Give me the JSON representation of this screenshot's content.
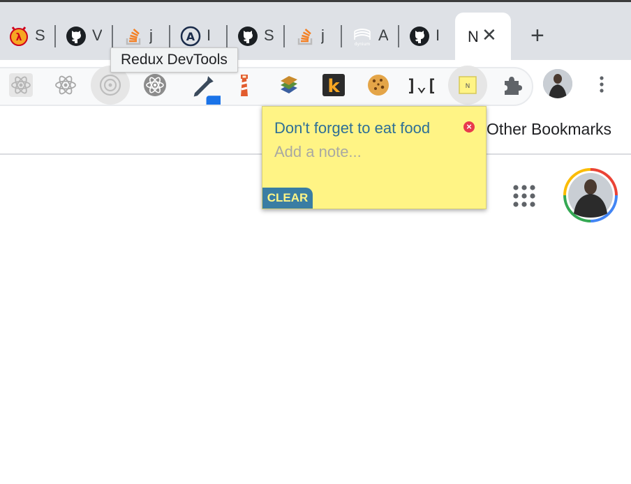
{
  "tabs": [
    {
      "icon": "lambda-icon",
      "title": "S"
    },
    {
      "icon": "github-icon",
      "title": "V"
    },
    {
      "icon": "stackoverflow-icon",
      "title": "j"
    },
    {
      "icon": "apollo-icon",
      "title": "I"
    },
    {
      "icon": "github-icon",
      "title": "S"
    },
    {
      "icon": "stackoverflow-icon",
      "title": "j"
    },
    {
      "icon": "dynium-icon",
      "title": "A"
    },
    {
      "icon": "github-icon",
      "title": "I"
    },
    {
      "icon": "new-tab-icon",
      "title": "N",
      "active": true
    }
  ],
  "dynium_label": "dynium",
  "tooltip": "Redux DevTools",
  "extensions": [
    "react-devtools-icon",
    "react-icon",
    "redux-devtools-icon",
    "react-alt-icon",
    "eyedropper-icon",
    "lighthouse-icon",
    "stack-books-icon",
    "k-icon",
    "cookie-icon",
    "bracket-icon",
    "sticky-note-icon",
    "puzzle-icon"
  ],
  "extension_glyphs": {
    "k": "k",
    "bracket": "]⌄["
  },
  "bookmarks": {
    "other": "Other Bookmarks"
  },
  "note": {
    "items": [
      "Don't forget to eat food"
    ],
    "placeholder": "Add a note...",
    "delete_glyph": "×",
    "clear_label": "CLEAR"
  },
  "colors": {
    "note_bg": "#fff485",
    "note_text": "#2e6f96",
    "clear_bg": "#3a7da3",
    "delete_red": "#e8394d"
  }
}
